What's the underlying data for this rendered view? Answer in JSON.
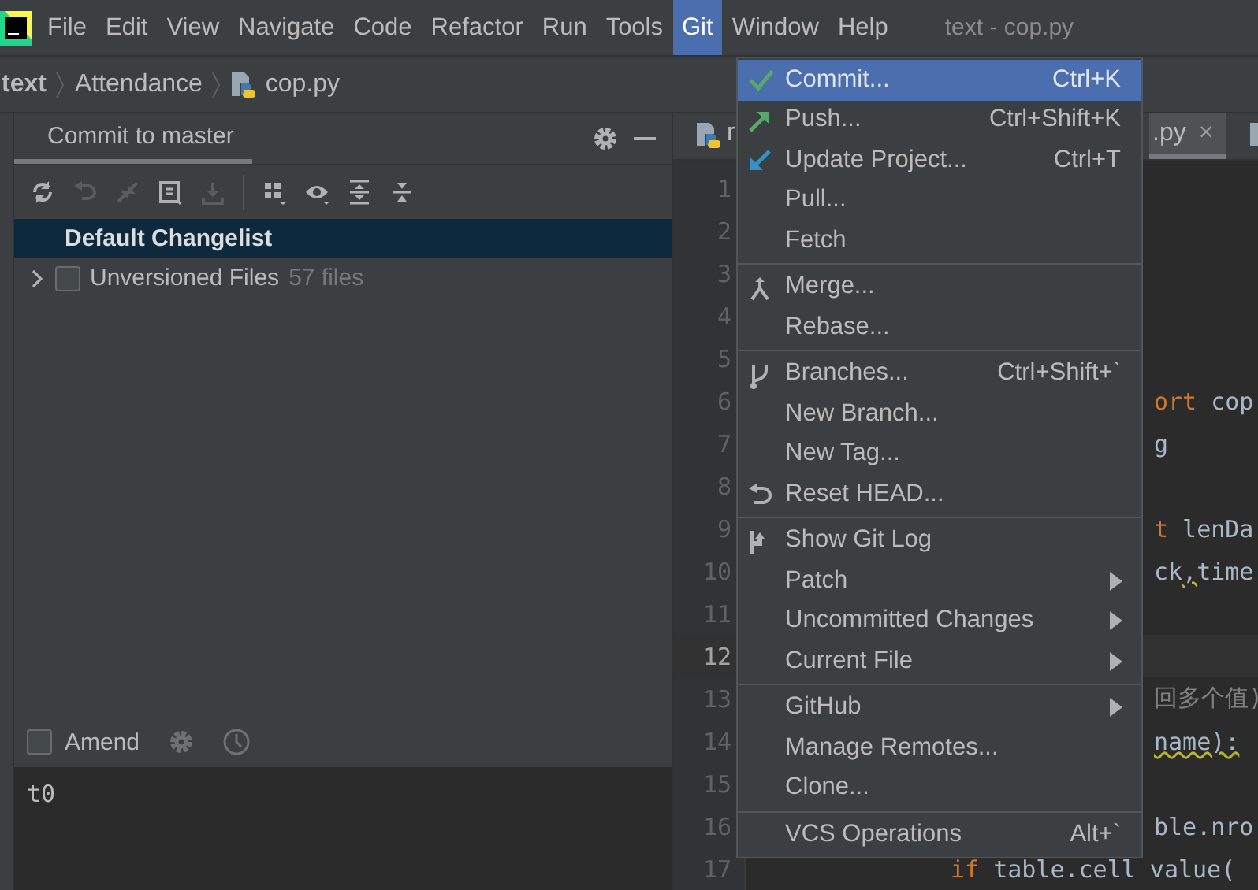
{
  "menubar": {
    "items": [
      {
        "label": "File",
        "selected": false
      },
      {
        "label": "Edit",
        "selected": false
      },
      {
        "label": "View",
        "selected": false
      },
      {
        "label": "Navigate",
        "selected": false
      },
      {
        "label": "Code",
        "selected": false
      },
      {
        "label": "Refactor",
        "selected": false
      },
      {
        "label": "Run",
        "selected": false
      },
      {
        "label": "Tools",
        "selected": false
      },
      {
        "label": "Git",
        "selected": true
      },
      {
        "label": "Window",
        "selected": false
      },
      {
        "label": "Help",
        "selected": false
      }
    ],
    "title": "text - cop.py"
  },
  "breadcrumbs": [
    {
      "label": "text",
      "kind": "folder"
    },
    {
      "label": "Attendance",
      "kind": "folder"
    },
    {
      "label": "cop.py",
      "kind": "file"
    }
  ],
  "commit_panel": {
    "title": "Commit to master",
    "toolbar": [
      {
        "kind": "refresh",
        "disabled": false
      },
      {
        "kind": "rollback",
        "disabled": true
      },
      {
        "kind": "diff",
        "disabled": true
      },
      {
        "kind": "message",
        "disabled": false
      },
      {
        "kind": "download",
        "disabled": true
      },
      {
        "kind": "group",
        "disabled": false
      },
      {
        "kind": "eye",
        "disabled": false
      },
      {
        "kind": "expand",
        "disabled": false
      },
      {
        "kind": "collapse",
        "disabled": false
      }
    ],
    "changelists": [
      {
        "label": "Default Changelist",
        "kind": "header",
        "selected": true
      },
      {
        "label": "Unversioned Files",
        "count": "57 files",
        "kind": "group",
        "checked": false,
        "selected": false
      }
    ],
    "amend": {
      "label": "Amend",
      "checked": false
    },
    "message": "t0"
  },
  "editor": {
    "tabs": [
      {
        "label": "r",
        "selected": false
      },
      {
        "label": ".py",
        "selected": true,
        "close": "×"
      },
      {
        "selected": false
      }
    ],
    "lines": [
      {
        "number": "1",
        "current": false,
        "kind": "behind_menu"
      },
      {
        "number": "2",
        "current": false,
        "kind": "behind_menu"
      },
      {
        "number": "3",
        "current": false,
        "kind": "behind_menu"
      },
      {
        "number": "4",
        "current": false,
        "kind": "behind_menu"
      },
      {
        "number": "5",
        "current": false,
        "kind": "behind_menu"
      },
      {
        "number": "6",
        "current": false,
        "kind": "behind_menu",
        "segments": [
          {
            "text": "ort",
            "kind": "keyword"
          },
          {
            "text": " cop",
            "kind": "plain"
          }
        ]
      },
      {
        "number": "7",
        "current": false,
        "kind": "behind_menu",
        "segments": [
          {
            "text": "g",
            "kind": "plain"
          }
        ]
      },
      {
        "number": "8",
        "current": false,
        "kind": "behind_menu"
      },
      {
        "number": "9",
        "current": false,
        "kind": "behind_menu",
        "segments": [
          {
            "text": "t",
            "kind": "keyword"
          },
          {
            "text": " lenDa",
            "kind": "plain"
          }
        ]
      },
      {
        "number": "10",
        "current": false,
        "kind": "behind_menu",
        "segments": [
          {
            "text": "ck",
            "kind": "plain"
          },
          {
            "text": ",",
            "kind": "warning"
          },
          {
            "text": "time",
            "kind": "plain"
          }
        ]
      },
      {
        "number": "11",
        "current": false,
        "kind": "behind_menu"
      },
      {
        "number": "12",
        "current": true,
        "kind": "behind_menu"
      },
      {
        "number": "13",
        "current": false,
        "kind": "behind_menu",
        "segments": [
          {
            "text": "回多个值)",
            "kind": "comment"
          }
        ]
      },
      {
        "number": "14",
        "current": false,
        "kind": "behind_menu",
        "segments": [
          {
            "text": "name):",
            "kind": "warning"
          }
        ]
      },
      {
        "number": "15",
        "current": false,
        "kind": "behind_menu"
      },
      {
        "number": "16",
        "current": false,
        "kind": "behind_menu",
        "segments": [
          {
            "text": "ble.nro",
            "kind": "plain"
          }
        ]
      },
      {
        "number": "17",
        "current": false,
        "kind": "below_menu",
        "segments": [
          {
            "text": "if",
            "kind": "keyword"
          },
          {
            "text": " table.cell value(",
            "kind": "plain"
          }
        ]
      }
    ]
  },
  "git_menu": {
    "groups": [
      [
        {
          "label": "Commit...",
          "shortcut": "Ctrl+K",
          "kind": "check",
          "selected": true
        },
        {
          "label": "Push...",
          "shortcut": "Ctrl+Shift+K",
          "kind": "push",
          "selected": false
        },
        {
          "label": "Update Project...",
          "shortcut": "Ctrl+T",
          "kind": "update",
          "selected": false
        },
        {
          "label": "Pull...",
          "selected": false
        },
        {
          "label": "Fetch",
          "selected": false
        }
      ],
      [
        {
          "label": "Merge...",
          "kind": "merge",
          "selected": false
        },
        {
          "label": "Rebase...",
          "selected": false
        }
      ],
      [
        {
          "label": "Branches...",
          "shortcut": "Ctrl+Shift+`",
          "kind": "branch",
          "selected": false
        },
        {
          "label": "New Branch...",
          "selected": false
        },
        {
          "label": "New Tag...",
          "selected": false
        },
        {
          "label": "Reset HEAD...",
          "kind": "reset",
          "selected": false
        }
      ],
      [
        {
          "label": "Show Git Log",
          "kind": "log",
          "selected": false
        },
        {
          "label": "Patch",
          "submenu": true,
          "selected": false
        },
        {
          "label": "Uncommitted Changes",
          "submenu": true,
          "selected": false
        },
        {
          "label": "Current File",
          "submenu": true,
          "selected": false
        }
      ],
      [
        {
          "label": "GitHub",
          "submenu": true,
          "selected": false
        },
        {
          "label": "Manage Remotes...",
          "selected": false
        },
        {
          "label": "Clone...",
          "selected": false
        }
      ],
      [
        {
          "label": "VCS Operations",
          "shortcut": "Alt+`",
          "selected": false
        }
      ]
    ]
  }
}
